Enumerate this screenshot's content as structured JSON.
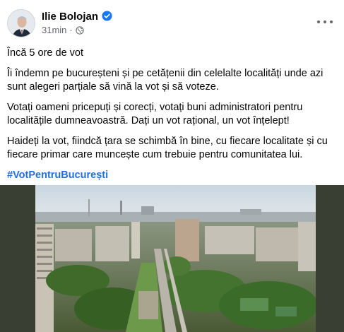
{
  "post": {
    "author": "Ilie Bolojan",
    "time": "31min",
    "separator": "·",
    "paragraphs": [
      "Încă 5 ore de vot",
      "Îi îndemn pe bucureșteni și pe cetățenii din celelalte localități unde azi sunt alegeri parțiale să vină la vot și să voteze.",
      "Votați oameni pricepuți și corecți, votați buni administratori pentru localitățile dumneavoastră. Dați un vot rațional, un vot înțelept!",
      "Haideți la vot, fiindcă țara se schimbă în bine, cu fiecare localitate și cu fiecare primar care muncește cum trebuie pentru comunitatea lui."
    ],
    "hashtag": "#VotPentruBucurești"
  },
  "icons": {
    "verified": "verified-badge-icon",
    "audience": "globe-icon",
    "more": "more-options-icon"
  },
  "colors": {
    "verified": "#1877f2",
    "hashtag": "#216fdb",
    "meta": "#65676b"
  }
}
